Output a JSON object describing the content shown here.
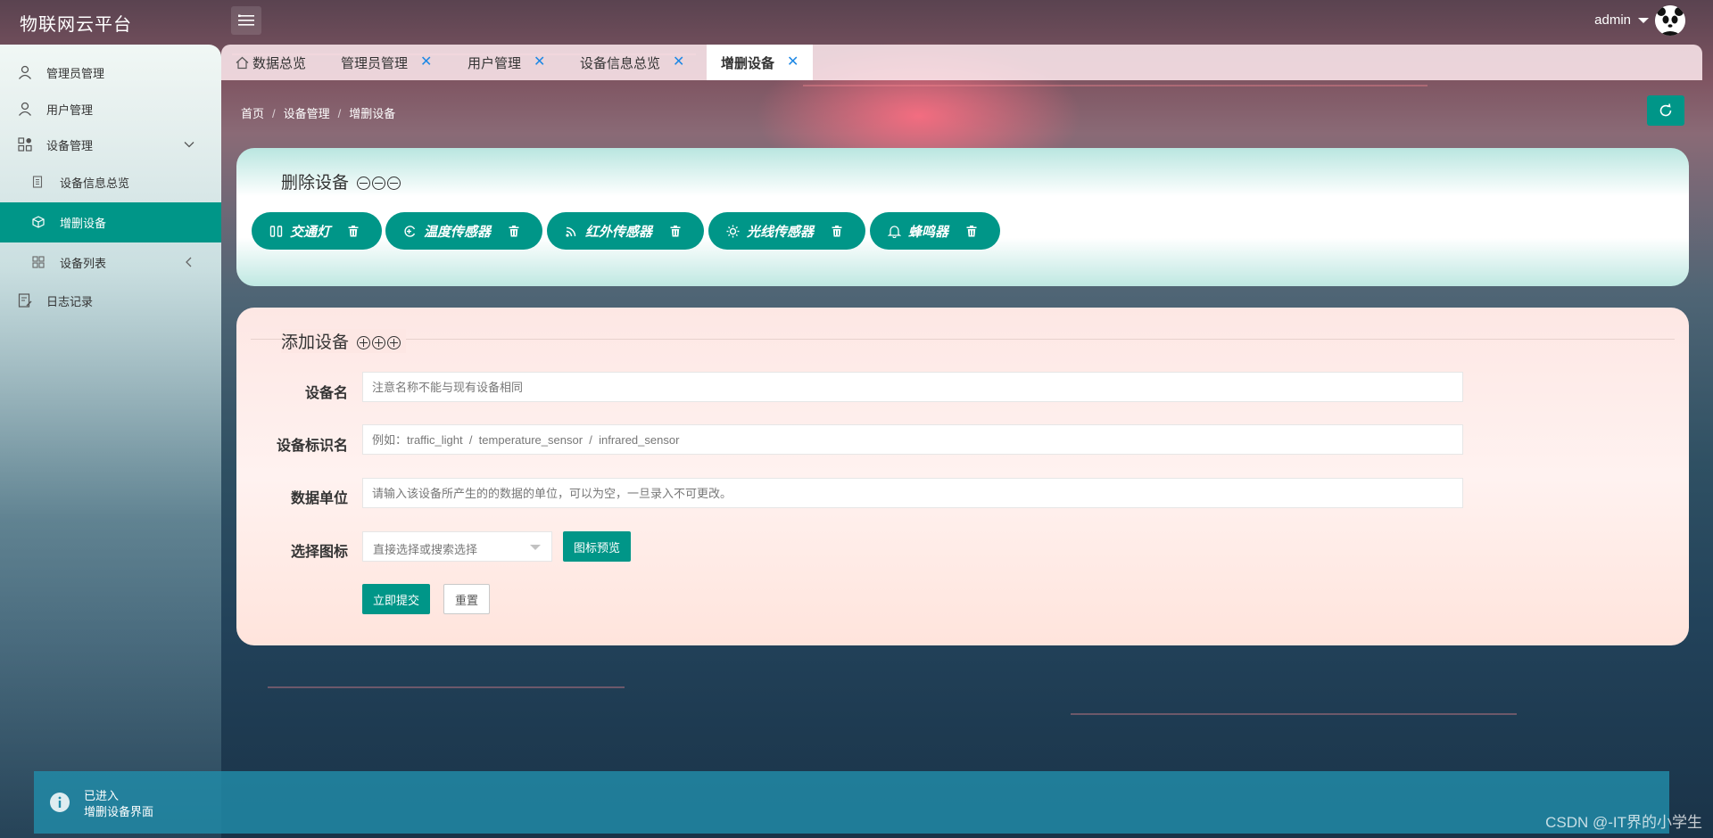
{
  "app": {
    "title": "物联网云平台"
  },
  "header": {
    "user": "admin"
  },
  "sidebar": {
    "items": [
      {
        "label": "管理员管理"
      },
      {
        "label": "用户管理"
      },
      {
        "label": "设备管理"
      },
      {
        "label": "设备信息总览"
      },
      {
        "label": "增删设备"
      },
      {
        "label": "设备列表"
      },
      {
        "label": "日志记录"
      }
    ]
  },
  "tabs": [
    {
      "label": "数据总览"
    },
    {
      "label": "管理员管理"
    },
    {
      "label": "用户管理"
    },
    {
      "label": "设备信息总览"
    },
    {
      "label": "增删设备"
    }
  ],
  "tab_close": "✕",
  "breadcrumb": {
    "items": [
      "首页",
      "设备管理",
      "增删设备"
    ],
    "sep": "/"
  },
  "delete_section": {
    "title": "删除设备",
    "devices": [
      {
        "label": "交通灯",
        "icon": "traffic-light-icon"
      },
      {
        "label": "温度传感器",
        "icon": "thermometer-icon"
      },
      {
        "label": "红外传感器",
        "icon": "rss-icon"
      },
      {
        "label": "光线传感器",
        "icon": "sun-icon"
      },
      {
        "label": "蜂鸣器",
        "icon": "bell-icon"
      }
    ]
  },
  "add_section": {
    "title": "添加设备",
    "fields": {
      "name": {
        "label": "设备名",
        "placeholder": "注意名称不能与现有设备相同",
        "value": ""
      },
      "identifier": {
        "label": "设备标识名",
        "placeholder": "例如：traffic_light  /  temperature_sensor  /  infrared_sensor",
        "value": ""
      },
      "unit": {
        "label": "数据单位",
        "placeholder": "请输入该设备所产生的的数据的单位，可以为空，一旦录入不可更改。",
        "value": ""
      },
      "icon": {
        "label": "选择图标",
        "placeholder": "直接选择或搜索选择"
      }
    },
    "preview_button": "图标预览",
    "submit_button": "立即提交",
    "reset_button": "重置"
  },
  "toast": {
    "line1": "已进入",
    "line2": "增删设备界面"
  },
  "watermark": "CSDN @-IT界的小学生",
  "colors": {
    "primary": "#009688",
    "tab_close": "#1e88e5",
    "toast": "#218caa"
  }
}
